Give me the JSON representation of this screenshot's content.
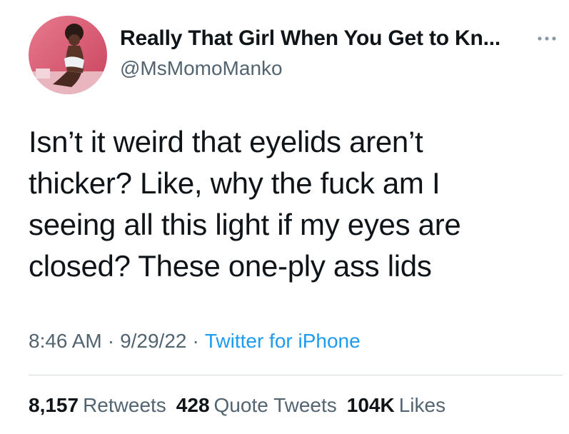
{
  "author": {
    "display_name": "Really That Girl When You Get to Kn...",
    "handle": "@MsMomoManko",
    "avatar_icon": "profile-photo"
  },
  "tweet": {
    "text": "Isn’t it weird that eyelids aren’t\nthicker? Like, why the fuck am I\nseeing all this light if my eyes are\nclosed? These one-ply ass lids"
  },
  "meta": {
    "time": "8:46 AM",
    "separator": "·",
    "date": "9/29/22",
    "source": "Twitter for iPhone"
  },
  "stats": {
    "retweets_count": "8,157",
    "retweets_label": "Retweets",
    "quotes_count": "428",
    "quotes_label": "Quote Tweets",
    "likes_count": "104K",
    "likes_label": "Likes"
  },
  "colors": {
    "text_primary": "#0f1419",
    "text_secondary": "#536471",
    "link": "#1d9bf0",
    "divider": "#cfd9de",
    "avatar_bg": "#d9607a"
  },
  "icons": {
    "more": "more-dots-icon"
  }
}
